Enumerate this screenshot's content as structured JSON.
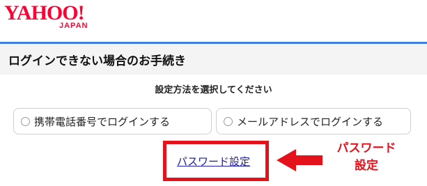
{
  "logo": {
    "main": "YAHOO!",
    "sub": "JAPAN"
  },
  "header": {
    "title": "ログインできない場合のお手続き"
  },
  "main": {
    "instruction": "設定方法を選択してください",
    "options": [
      {
        "label": "携帯電話番号でログインする"
      },
      {
        "label": "メールアドレスでログインする"
      }
    ],
    "link": "パスワード設定"
  },
  "annotation": {
    "line1": "パスワード",
    "line2": "設定",
    "color": "#e3121b"
  }
}
